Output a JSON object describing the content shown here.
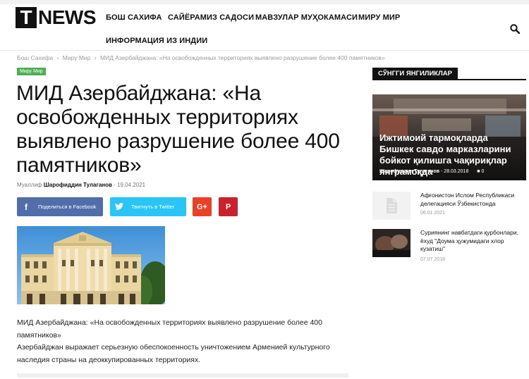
{
  "brand": {
    "t": "T",
    "news": "NEWS"
  },
  "nav": {
    "items": [
      "БОШ САХИФА",
      "САЙЁРАМИЗ САДОСИ",
      "МАВЗУЛАР МУҲОКАМАСИ",
      "МИРУ МИР",
      "ИНФОРМАЦИЯ ИЗ ИНДИИ"
    ],
    "search_icon": "search-icon"
  },
  "breadcrumb": {
    "items": [
      "Бош Сахифа",
      "Миру Мир",
      "МИД Азербайджана: «На освобожденных территориях выявлено разрушение более 400 памятников»"
    ],
    "separator": "›"
  },
  "article": {
    "category": "Миру Мир",
    "title": "МИД Азербайджана: «На освобожденных территориях выявлено разрушение более 400 памятников»",
    "author_label": "Муаллиф",
    "author": "Шарофиддин Тулаганов",
    "date_sep": "-",
    "date": "19.04.2021",
    "share": {
      "facebook": "Поделиться в Facebook",
      "twitter": "Твитнуть в Twitter",
      "gplus": "G+",
      "pinterest": "P",
      "facebook_color": "#516eab",
      "twitter_color": "#29c5f6",
      "gplus_color": "#eb4026",
      "pinterest_color": "#ca212a"
    },
    "paragraphs": [
      "МИД Азербайджана: «На освобожденных территориях выявлено разрушение более 400 памятников»",
      "Азербайджан выражает серьезную обеспокоенность уничтожением Арменией культурного наследия страны на деоккупированных территориях."
    ]
  },
  "sidebar": {
    "heading": "СЎНГГИ ЯНГИЛИКЛАР",
    "featured": {
      "title": "Ижтимоий тармоқларда Бишкек савдо марказларини бойкот қилишга чақириқлар янграмоқда",
      "author": "Шарофиддин Тулаганов",
      "date_sep": "-",
      "date": "28.03.2018",
      "comments": "0"
    },
    "items": [
      {
        "title": "Афғонистон Ислом Республикаси делегацияси Ўзбекистонда",
        "date": "06.01.2021"
      },
      {
        "title": "Суриянинг навбатдаги қурбонлари, ёхуд \"Доума ҳужумидаги хлор кузатиш\"",
        "date": "07.07.2018"
      }
    ]
  }
}
